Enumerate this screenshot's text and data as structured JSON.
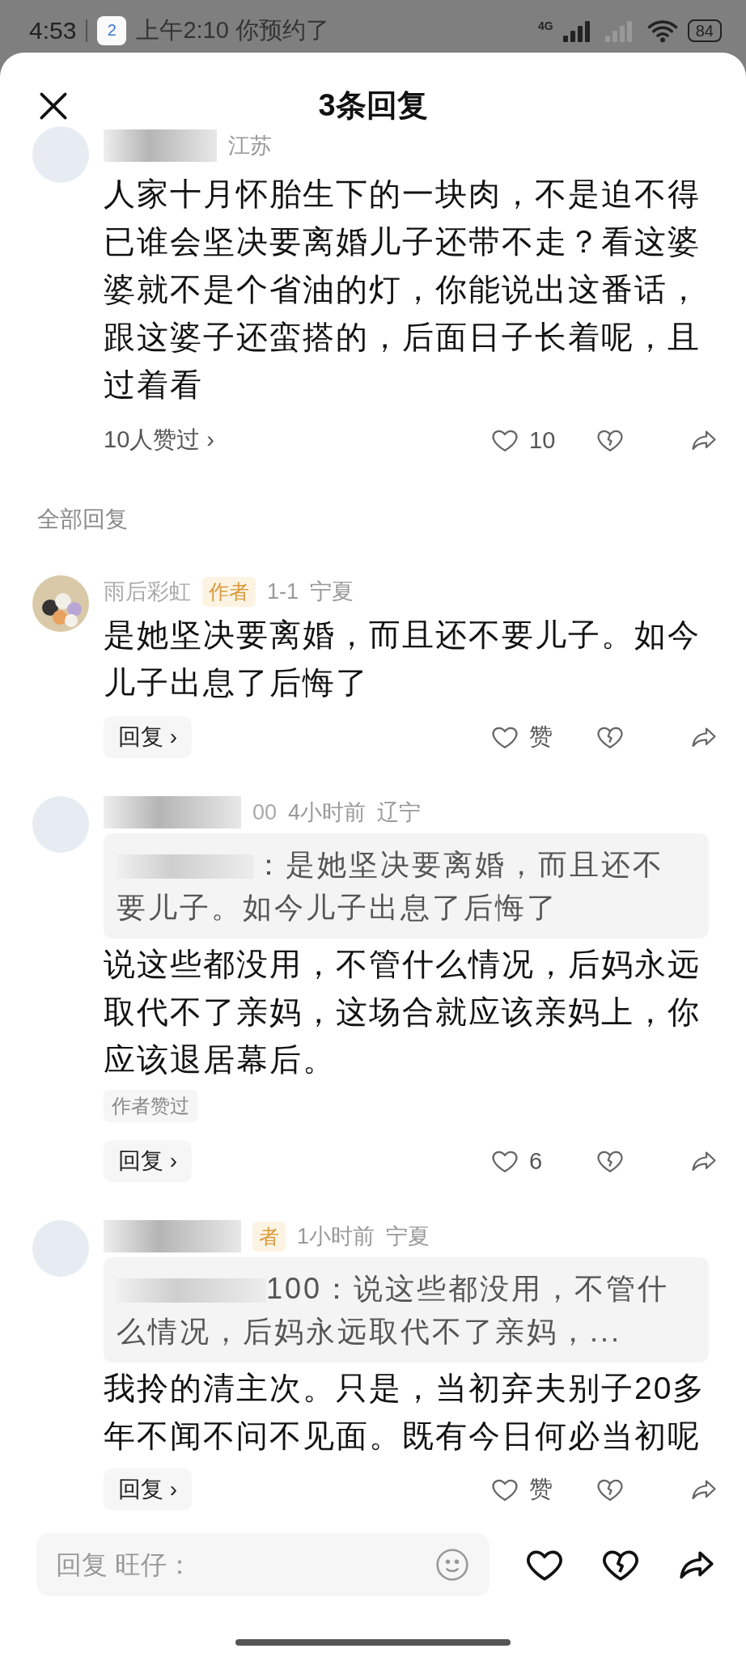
{
  "status_bar": {
    "time": "4:53",
    "app_badge": "2",
    "notification": "上午2:10 你预约了",
    "network": "4G",
    "battery": "84"
  },
  "header": {
    "title": "3条回复"
  },
  "main_comment": {
    "location": "江苏",
    "text": "人家十月怀胎生下的一块肉，不是迫不得已谁会坚决要离婚儿子还带不走？看这婆婆就不是个省油的灯，你能说出这番话，跟这婆子还蛮搭的，后面日子长着呢，且过着看",
    "likes_summary": "10人赞过 ›",
    "like_label": "10"
  },
  "section_label": "全部回复",
  "replies": [
    {
      "name": "雨后彩虹",
      "name_partly_hidden": false,
      "badge": "作者",
      "time": "1-1",
      "location": "宁夏",
      "text": "是她坚决要离婚，而且还不要儿子。如今儿子出息了后悔了",
      "reply_button": "回复 ›",
      "like_label": "赞"
    },
    {
      "name": "00",
      "name_partly_hidden": true,
      "time": "4小时前",
      "location": "辽宁",
      "quote": "：是她坚决要离婚，而且还不要儿子。如今儿子出息了后悔了",
      "text": "说这些都没用，不管什么情况，后妈永远取代不了亲妈，这场合就应该亲妈上，你应该退居幕后。",
      "tag": "作者赞过",
      "reply_button": "回复 ›",
      "like_label": "6"
    },
    {
      "name_partly_hidden": true,
      "badge": "者",
      "time": "1小时前",
      "location": "宁夏",
      "quote": "100：说这些都没用，不管什么情况，后妈永远取代不了亲妈，...",
      "text": "我拎的清主次。只是，当初弃夫别子20多年不闻不问不见面。既有今日何必当初呢",
      "reply_button": "回复 ›",
      "like_label": "赞"
    }
  ],
  "composer": {
    "placeholder": "回复 旺仔："
  }
}
